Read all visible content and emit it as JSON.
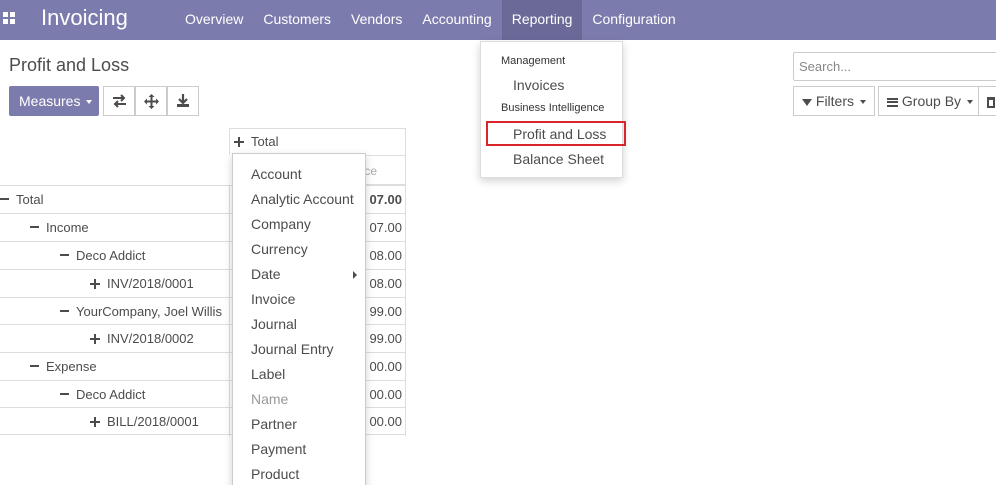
{
  "nav": {
    "app_title": "Invoicing",
    "menu": [
      "Overview",
      "Customers",
      "Vendors",
      "Accounting",
      "Reporting",
      "Configuration"
    ],
    "active_menu": "Reporting"
  },
  "reporting_menu": {
    "section1": "Management",
    "item_invoices": "Invoices",
    "section2": "Business Intelligence",
    "item_profit_loss": "Profit and Loss",
    "item_balance_sheet": "Balance Sheet"
  },
  "control": {
    "breadcrumb": "Profit and Loss",
    "measures_label": "Measures",
    "search_placeholder": "Search...",
    "filters_label": "Filters",
    "groupby_label": "Group By"
  },
  "pivot": {
    "col_header": "Total",
    "measure_header": "ance",
    "rows": [
      {
        "label": "Total",
        "value": "07.00"
      },
      {
        "label": "Income",
        "value": "07.00"
      },
      {
        "label": "Deco Addict",
        "value": "08.00"
      },
      {
        "label": "INV/2018/0001",
        "value": "08.00"
      },
      {
        "label": "YourCompany, Joel Willis",
        "value": "99.00"
      },
      {
        "label": "INV/2018/0002",
        "value": "99.00"
      },
      {
        "label": "Expense",
        "value": "00.00"
      },
      {
        "label": "Deco Addict",
        "value": "00.00"
      },
      {
        "label": "BILL/2018/0001",
        "value": "00.00"
      }
    ]
  },
  "groupby_menu": {
    "items": [
      "Account",
      "Analytic Account",
      "Company",
      "Currency",
      "Date",
      "Invoice",
      "Journal",
      "Journal Entry",
      "Label",
      "Name",
      "Partner",
      "Payment",
      "Product"
    ]
  }
}
